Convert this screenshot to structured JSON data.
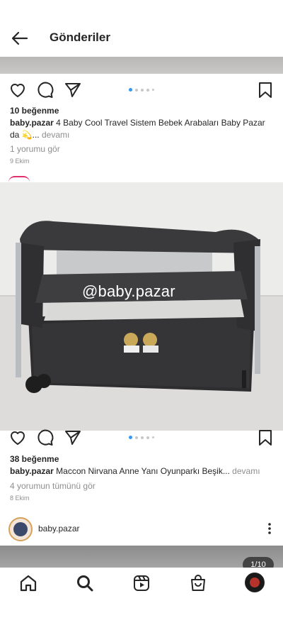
{
  "header": {
    "title": "Gönderiler"
  },
  "post1": {
    "likes": "10 beğenme",
    "username": "baby.pazar",
    "caption": " 4 Baby Cool  Travel Sistem Bebek Arabaları Baby Pazar da 💫... ",
    "more": "devamı",
    "comments": "1 yorumu gör",
    "date": "9 Ekim",
    "carousel_active": 0,
    "carousel_count": 5
  },
  "post2": {
    "watermark": "@baby.pazar",
    "likes": "38 beğenme",
    "username": "baby.pazar",
    "caption": " Maccon Nirvana Anne Yanı Oyunparkı Beşik... ",
    "more": "devamı",
    "comments": "4 yorumun tümünü gör",
    "date": "8 Ekim",
    "carousel_active": 0,
    "carousel_count": 5
  },
  "post3": {
    "username": "baby.pazar",
    "page_counter": "1/10"
  },
  "nav": {
    "items": [
      "home-icon",
      "search-icon",
      "reels-icon",
      "shop-icon",
      "profile-avatar"
    ]
  },
  "colors": {
    "accent": "#3897f0",
    "text": "#262626",
    "muted": "#8e8e8e"
  }
}
